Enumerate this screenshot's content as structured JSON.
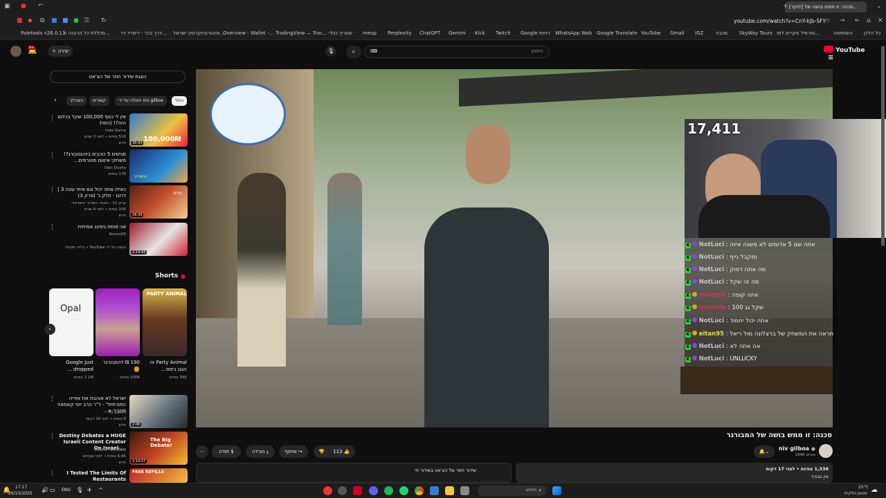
{
  "browser": {
    "tab_title": "[לוקד] סכנה: זו ממש בושה של...",
    "url": "youtube.com/watch?v=CnY-kJb-SFY",
    "bookmarks": [
      "Paletools v26.0.11",
      "מכללת כל הרבנה ה...",
      "דרך בכר - דיפרד דר...",
      "אינטרוביוקרטיב ישראל...",
      "Overview - Wallet -...",
      "TradingView — Trac...",
      "שעריך ככלי",
      "meup",
      "Perplexity",
      "ChatGPT",
      "Gemini",
      "Kick",
      "Twitch",
      "Google רוויות",
      "WhatsApp Web",
      "Google Translate",
      "YouTube",
      "Gmail",
      "IGZ",
      "מכבה",
      "SkyWay Tours",
      "פורמיל סקרים למו...",
      "השתתפה",
      "כל הלכן"
    ]
  },
  "header": {
    "search_placeholder": "חיפוש",
    "create_label": "יצירה",
    "logo_text": "YouTube",
    "notif_count": "9+"
  },
  "sidebar": {
    "live_chat_button": "הצגת שידור חוזר של הצ'אט",
    "chips": [
      "הכול",
      "הועלה על ידי niv gilboa",
      "קשורים",
      "בשבילך"
    ],
    "recs": [
      {
        "title": "אין לי כסף 100,000 שקל בכלום הזה?! (ניסוי)",
        "channel": "Inde Game",
        "meta": "51K צפיות • לפני 3 שנים",
        "badge": "חדש",
        "duration": "35:43",
        "thumb_text": "100,000₪"
      },
      {
        "title": "מגישים 5 כוכבים ביוהנסבורג?! משחקי איטום מטורפים...",
        "channel": "Idan Dushy",
        "meta": "178 צפיות",
        "badge": "",
        "duration": "",
        "thumb_text": "ובשידור"
      },
      {
        "title": "כאילו אתה יכול וגם איתי עונה 3 | דרום - חלק ג' (פרק 3)",
        "channel": "ערוץ 11 - תאגיד השידור הישראלי",
        "meta": "10K צפיות • לפני 4 שנים",
        "badge": "חדש",
        "duration": "28:39",
        "thumb_text": "עניים"
      },
      {
        "title": "אני פותח גימינג אמיתית",
        "channel": "Ronen00",
        "meta": "נעשה על ידי YouTube • בלייר מעולה",
        "badge": "",
        "duration": "2:14:43",
        "thumb_text": ""
      },
      {
        "title": "ישראל לא אוהבת את אודיה התורתית\" - ד\"ר הרב יוסי קאמאזי מסביר א...",
        "channel": "דפוקים TV",
        "meta": "8 צפיות • לפני 16 דקות",
        "badge": "חדש",
        "duration": "2:08",
        "thumb_text": ""
      },
      {
        "title": "Destiny Debates a HUGE Israeli Content Creator On Israel-...",
        "channel": "Moshe Fabrikant",
        "meta": "6.8K צפיות • לפני שעתיים",
        "badge": "חדש",
        "duration": "2:14:57",
        "thumb_text": "The Big Debate!"
      },
      {
        "title": "I Tested The Limits Of Restaurants",
        "channel": "",
        "meta": "",
        "badge": "",
        "duration": "",
        "thumb_text": "FREE REFILLS"
      }
    ],
    "shorts_label": "Shorts",
    "shorts": [
      {
        "title": "Party Animal זה הגגג ביסס...",
        "views": "36K צפיות",
        "thumb_text": "PARTY ANIMAL"
      },
      {
        "title": "190 ₪ להמבורגר 🍔",
        "views": "200K צפיות",
        "thumb_text": ""
      },
      {
        "title": "Google Just dropped ...",
        "views": "1.1M צפיות",
        "thumb_text": "Opal"
      }
    ]
  },
  "player": {
    "viewer_count": "17,411",
    "chat": [
      {
        "user": "NotLuci",
        "msg": "אתה שם 5 אדומים לא משנה איזה"
      },
      {
        "user": "NotLuci",
        "msg": "ומקבל נייף"
      },
      {
        "user": "NotLuci",
        "msg": "מה אתה דפוק"
      },
      {
        "user": "NotLuci",
        "msg": "מה זה שקל"
      },
      {
        "user": "qvustrix",
        "msg": "איזה קופה"
      },
      {
        "user": "qvustrix",
        "msg": "שקל גג 100"
      },
      {
        "user": "NotLuci",
        "msg": "אתה יכול יחמוד"
      },
      {
        "user": "eitan95",
        "msg": "תראה את המשחק של ברצלונה מול ריאל"
      },
      {
        "user": "NotLuci",
        "msg": "אה אתה לא"
      },
      {
        "user": "NotLuci",
        "msg": "UNLUCKY"
      }
    ]
  },
  "video": {
    "title": "סכנה: זו ממש בושה של המבורגר",
    "channel": "niv gilboa",
    "subscribers": "184K מנויים",
    "likes": "113",
    "share_label": "שיתוף",
    "download_label": "הורדה",
    "thanks_label": "תודה",
    "views_line": "1,336 צפיות • לפני 17 דקות",
    "desc_line": "אין גבוה!",
    "live_chat_replay": "שידור חוזר של הצ'אט בשידור חי"
  },
  "taskbar": {
    "time": "17:17",
    "date": "26/10/2025",
    "lang": "ENG",
    "search_label": "חיפוש",
    "weather_temp": "25°C",
    "weather_text": "מעונן חלקית"
  }
}
